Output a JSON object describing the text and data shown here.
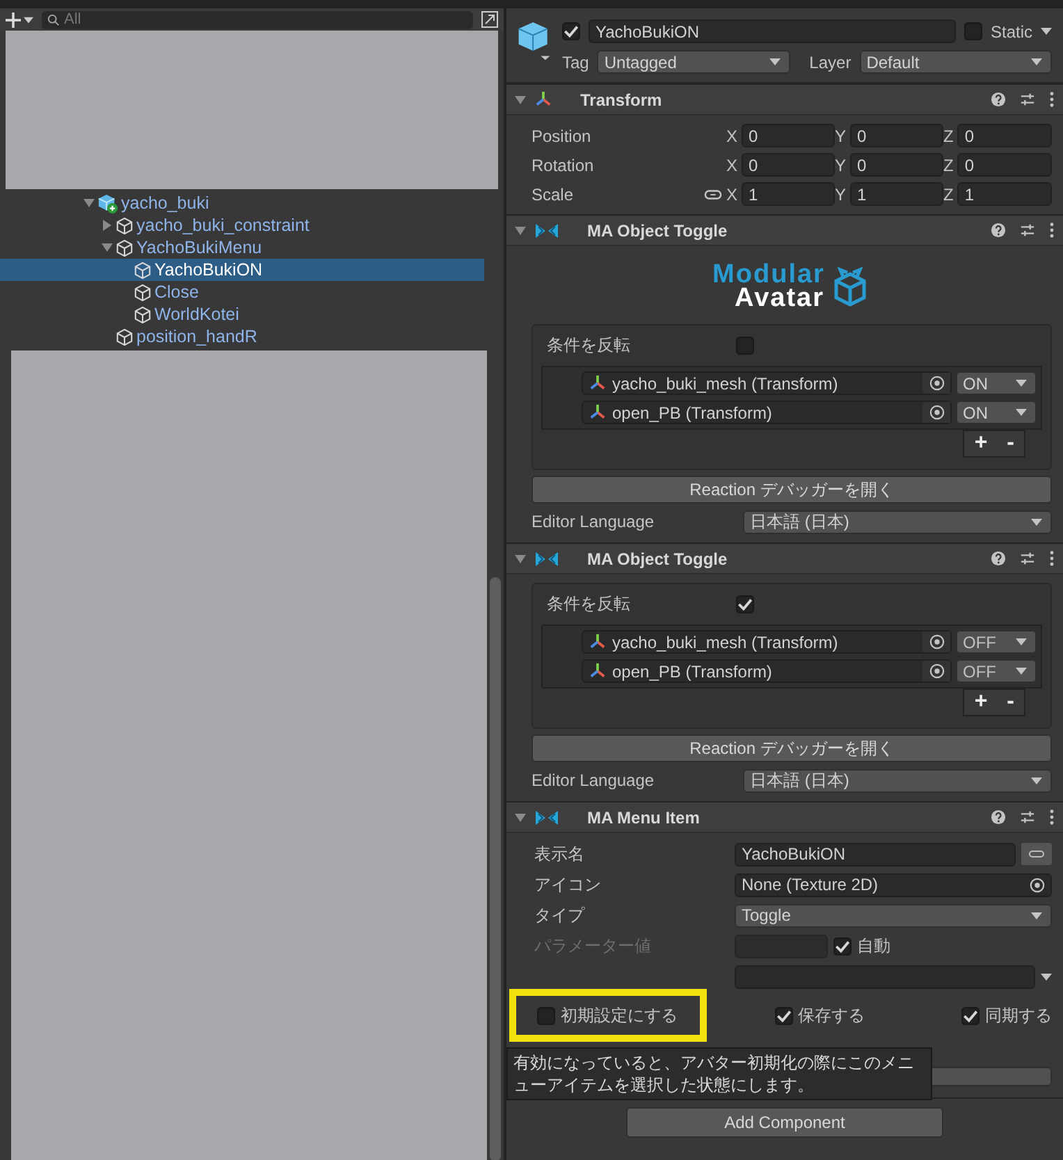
{
  "hierarchy": {
    "search": {
      "placeholder": "All"
    },
    "tree": [
      {
        "name": "yacho_buki",
        "kind": "prefab",
        "expanded": true,
        "selected": false,
        "children": [
          {
            "name": "yacho_buki_constraint",
            "kind": "object",
            "expanded": false,
            "selected": false
          },
          {
            "name": "YachoBukiMenu",
            "kind": "object",
            "expanded": true,
            "selected": false,
            "children": [
              {
                "name": "YachoBukiON",
                "kind": "object",
                "selected": true
              },
              {
                "name": "Close",
                "kind": "object",
                "selected": false
              },
              {
                "name": "WorldKotei",
                "kind": "object",
                "selected": false
              }
            ]
          },
          {
            "name": "position_handR",
            "kind": "object",
            "selected": false
          }
        ]
      }
    ]
  },
  "inspector": {
    "object": {
      "active": true,
      "name": "YachoBukiON",
      "static": false,
      "static_label": "Static",
      "tag_label": "Tag",
      "tag": "Untagged",
      "layer_label": "Layer",
      "layer": "Default"
    },
    "components": [
      {
        "kind": "transform",
        "title": "Transform",
        "expanded": true,
        "rows": [
          {
            "label": "Position",
            "linked": false,
            "values": [
              {
                "axis": "X",
                "value": "0"
              },
              {
                "axis": "Y",
                "value": "0"
              },
              {
                "axis": "Z",
                "value": "0"
              }
            ]
          },
          {
            "label": "Rotation",
            "linked": false,
            "values": [
              {
                "axis": "X",
                "value": "0"
              },
              {
                "axis": "Y",
                "value": "0"
              },
              {
                "axis": "Z",
                "value": "0"
              }
            ]
          },
          {
            "label": "Scale",
            "linked": true,
            "values": [
              {
                "axis": "X",
                "value": "1"
              },
              {
                "axis": "Y",
                "value": "1"
              },
              {
                "axis": "Z",
                "value": "1"
              }
            ]
          }
        ]
      },
      {
        "kind": "object_toggle",
        "title": "MA Object Toggle",
        "expanded": true,
        "logo": {
          "line1": "Modular",
          "line2": "Avatar"
        },
        "invert_label": "条件を反転",
        "invert": false,
        "objects": [
          {
            "name": "yacho_buki_mesh (Transform)",
            "state": "ON"
          },
          {
            "name": "open_PB (Transform)",
            "state": "ON"
          }
        ],
        "add": "+",
        "remove": "-",
        "debug_button": "Reaction デバッガーを開く",
        "language_label": "Editor Language",
        "language": "日本語 (日本)"
      },
      {
        "kind": "object_toggle",
        "title": "MA Object Toggle",
        "expanded": true,
        "invert_label": "条件を反転",
        "invert": true,
        "objects": [
          {
            "name": "yacho_buki_mesh (Transform)",
            "state": "OFF"
          },
          {
            "name": "open_PB (Transform)",
            "state": "OFF"
          }
        ],
        "add": "+",
        "remove": "-",
        "debug_button": "Reaction デバッガーを開く",
        "language_label": "Editor Language",
        "language": "日本語 (日本)"
      },
      {
        "kind": "menu_item",
        "title": "MA Menu Item",
        "expanded": true,
        "fields": [
          {
            "kind": "text",
            "label": "表示名",
            "value": "YachoBukiON",
            "disabled": false
          },
          {
            "kind": "object",
            "label": "アイコン",
            "value": "None (Texture 2D)",
            "disabled": false
          },
          {
            "kind": "dropdown",
            "label": "タイプ",
            "value": "Toggle",
            "disabled": false
          },
          {
            "kind": "auto",
            "label": "パラメーター値",
            "disabled": true,
            "auto_label": "自動",
            "auto": true
          },
          {
            "kind": "combo",
            "disabled": false
          }
        ],
        "checkboxes": [
          {
            "label": "初期設定にする",
            "checked": false,
            "highlighted": true
          },
          {
            "label": "保存する",
            "checked": true,
            "highlighted": false
          },
          {
            "label": "同期する",
            "checked": true,
            "highlighted": false
          }
        ],
        "tooltip": "有効になっていると、アバター初期化の際にこのメニューアイテムを選択した状態にします。"
      }
    ],
    "add_component": "Add Component"
  }
}
